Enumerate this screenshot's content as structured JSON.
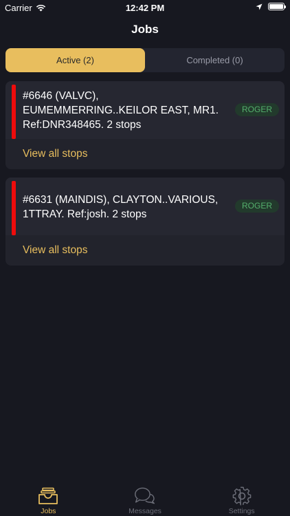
{
  "status_bar": {
    "carrier": "Carrier",
    "time": "12:42 PM"
  },
  "nav": {
    "title": "Jobs"
  },
  "segments": [
    {
      "label": "Active (2)",
      "selected": true
    },
    {
      "label": "Completed (0)",
      "selected": false
    }
  ],
  "jobs": [
    {
      "line1": "#6646 (VALVC),",
      "line2": "EUMEMMERRING..KEILOR EAST, MR1.",
      "line3": "Ref:DNR348465. 2 stops",
      "driver": "ROGER",
      "link": "View all stops"
    },
    {
      "line1": "#6631 (MAINDIS), CLAYTON..VARIOUS,",
      "line2": "1TTRAY. Ref:josh. 2 stops",
      "driver": "ROGER",
      "link": "View all stops"
    }
  ],
  "tabs": [
    {
      "label": "Jobs",
      "icon": "inbox-icon",
      "active": true
    },
    {
      "label": "Messages",
      "icon": "chat-bubbles-icon",
      "active": false
    },
    {
      "label": "Settings",
      "icon": "gear-icon",
      "active": false
    }
  ],
  "colors": {
    "accent": "#e8be5e",
    "background": "#171820",
    "card": "#22232c",
    "priority_bar": "#ee0c0c",
    "badge_text": "#55b06d"
  }
}
